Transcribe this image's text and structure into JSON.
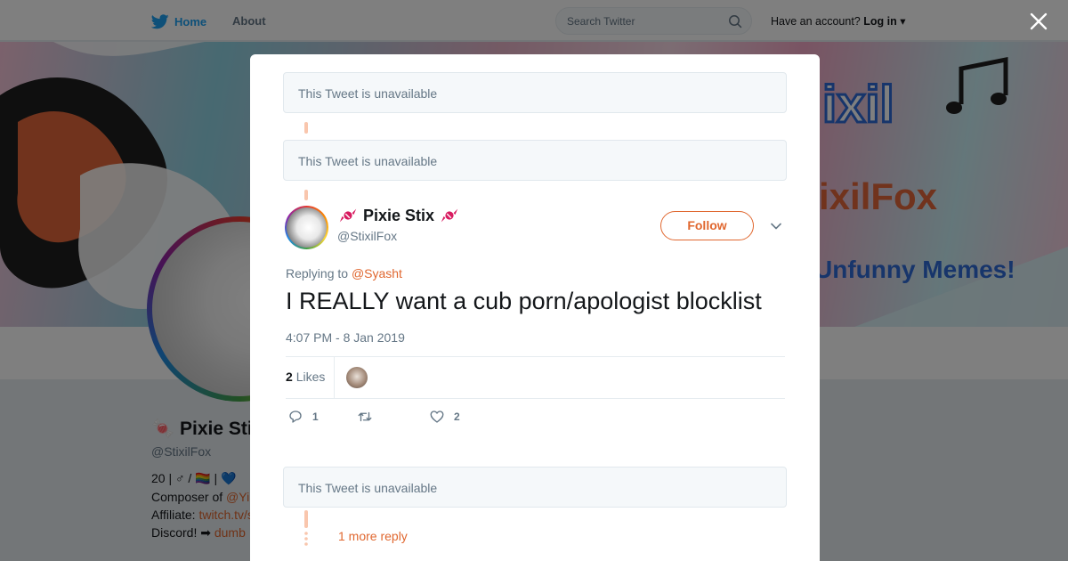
{
  "nav": {
    "home_label": "Home",
    "about_label": "About",
    "search_placeholder": "Search Twitter",
    "account_prompt": "Have an account?",
    "login_label": "Log in"
  },
  "banner": {
    "text_1": "ixilFox",
    "text_2": "Unfunny Memes!"
  },
  "profile": {
    "name": "Pixie Stix",
    "handle": "@StixilFox",
    "bio_line_1": "20 | ♂ / 🏳️‍🌈 | 💙",
    "bio_line_2_prefix": "Composer of ",
    "bio_line_2_link": "@Yi",
    "bio_line_3_prefix": "Affiliate: ",
    "bio_line_3_link": "twitch.tv/s",
    "bio_line_4_prefix": "Discord! ➡ ",
    "bio_line_4_link": "dumb"
  },
  "modal": {
    "unavailable_1": "This Tweet is unavailable",
    "unavailable_2": "This Tweet is unavailable",
    "unavailable_3": "This Tweet is unavailable",
    "tweet": {
      "author_name": "Pixie Stix",
      "author_handle": "@StixilFox",
      "follow_label": "Follow",
      "replying_prefix": "Replying to",
      "replying_to": "@Syasht",
      "text": "I REALLY want a cub porn/apologist blocklist",
      "timestamp": "4:07 PM - 8 Jan 2019",
      "likes_count": "2",
      "likes_label": "Likes",
      "reply_count": "1",
      "retweet_count": "",
      "like_count": "2"
    },
    "more_reply_label": "1 more reply"
  },
  "colors": {
    "accent": "#e0672f",
    "twitter_blue": "#1da1f2",
    "thread_line": "#f9c6ad"
  },
  "icons": {
    "logo": "twitter-bird-icon",
    "search": "search-icon",
    "close": "close-icon",
    "chevron": "chevron-down-icon",
    "reply": "reply-icon",
    "retweet": "retweet-icon",
    "like": "heart-icon",
    "candy": "candy-emoji-icon"
  }
}
